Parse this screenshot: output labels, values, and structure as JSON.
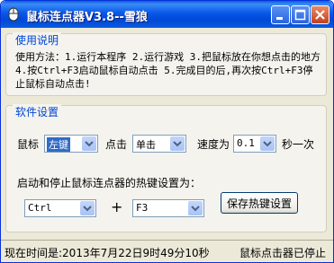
{
  "window": {
    "title": "鼠标连点器V3.8--雪狼"
  },
  "usage": {
    "legend": "使用说明",
    "text": "使用方法：1.运行本程序 2.运行游戏 3.把鼠标放在你想点击的地方 4.按Ctrl+F3启动鼠标自动点击 5.完成目的后,再次按Ctrl+F3停止鼠标自动点击!"
  },
  "settings": {
    "legend": "软件设置",
    "mouse_label": "鼠标",
    "mouse_button": "左键",
    "click_label": "点击",
    "click_type": "单击",
    "speed_label": "速度为",
    "speed_value": "0.1",
    "speed_unit": "秒一次",
    "hotkey_label": "启动和停止鼠标连点器的热键设置为：",
    "modifier_key": "Ctrl",
    "plus_sign": "+",
    "function_key": "F3",
    "save_button": "保存热键设置"
  },
  "status": {
    "time": "现在时间是:2013年7月22日9时49分10秒",
    "state": "鼠标点击器已停止"
  }
}
